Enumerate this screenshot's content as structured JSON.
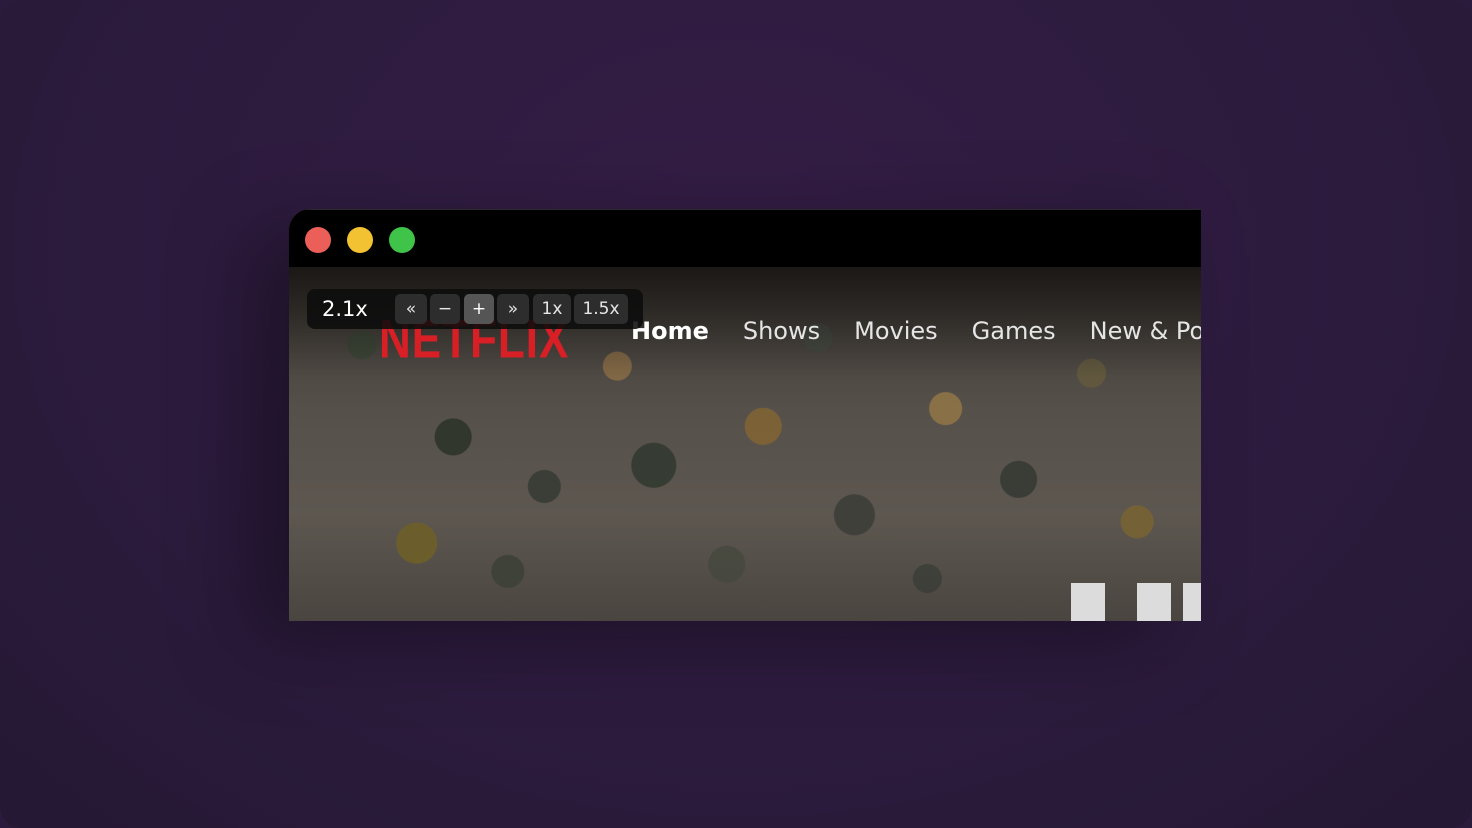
{
  "zoom_toolbar": {
    "level": "2.1x",
    "buttons": {
      "first": "«",
      "zoom_out": "−",
      "zoom_in": "+",
      "last": "»",
      "preset_1x": "1x",
      "preset_15x": "1.5x"
    }
  },
  "netflix": {
    "logo": "NETFLIX",
    "nav": [
      "Home",
      "Shows",
      "Movies",
      "Games",
      "New & Pop"
    ]
  },
  "colors": {
    "brand_red": "#d81f26",
    "traffic_close": "#ec5f58",
    "traffic_minimize": "#f3c232",
    "traffic_zoom": "#3fc349",
    "desktop_bg": "#2c1b3d"
  }
}
